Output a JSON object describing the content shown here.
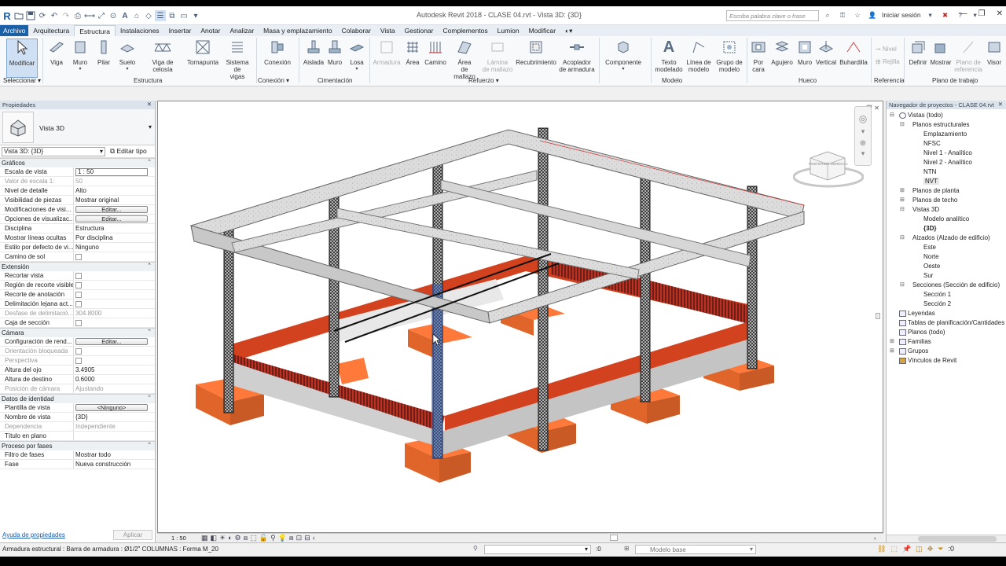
{
  "titlebar": {
    "window_title": "Autodesk Revit 2018 -    CLASE 04.rvt - Vista 3D: {3D}",
    "search_placeholder": "Escriba palabra clave o frase",
    "signin": "Iniciar sesión"
  },
  "tabs": [
    "Archivo",
    "Arquitectura",
    "Estructura",
    "Instalaciones",
    "Insertar",
    "Anotar",
    "Analizar",
    "Masa y emplazamiento",
    "Colaborar",
    "Vista",
    "Gestionar",
    "Complementos",
    "Lumion",
    "Modificar"
  ],
  "active_tab": "Estructura",
  "ribbon": {
    "modify": "Modificar",
    "select": "Seleccionar",
    "panels": [
      "Estructura",
      "Conexión",
      "Cimentación",
      "Refuerzo",
      "Modelo",
      "Hueco",
      "Referencia",
      "Plano de trabajo"
    ],
    "buttons": {
      "viga": "Viga",
      "muro": "Muro",
      "pilar": "Pilar",
      "suelo": "Suelo",
      "celosia": "Viga de celosía",
      "tornapunta": "Tornapunta",
      "sistema1": "Sistema de",
      "sistema2": "vigas",
      "conexion": "Conexión",
      "aislada": "Aislada",
      "muro_c": "Muro",
      "losa": "Losa",
      "armadura": "Armadura",
      "area": "Área",
      "camino": "Camino",
      "area_mallazo1": "Área",
      "area_mallazo2": "de mallazo",
      "lamina1": "Lámina",
      "lamina2": "de mallazo",
      "recubrimiento": "Recubrimiento",
      "acoplador1": "Acoplador",
      "acoplador2": "de armadura",
      "componente": "Componente",
      "texto1": "Texto",
      "texto2": "modelado",
      "linea1": "Línea de",
      "linea2": "modelo",
      "grupo1": "Grupo de",
      "grupo2": "modelo",
      "porcara1": "Por",
      "porcara2": "cara",
      "agujero": "Agujero",
      "muro_h": "Muro",
      "vertical": "Vertical",
      "buhardilla": "Buhardilla",
      "nivel": "Nivel",
      "rejilla": "Rejilla",
      "definir": "Definir",
      "mostrar": "Mostrar",
      "plano_ref1": "Plano de",
      "plano_ref2": "referencia",
      "visor": "Visor"
    }
  },
  "properties": {
    "header": "Propiedades",
    "type_name": "Vista 3D",
    "view_selector": "Vista 3D: {3D}",
    "edit_type": "Editar tipo",
    "sections": {
      "graficos": "Gráficos",
      "extension": "Extensión",
      "camara": "Cámara",
      "identidad": "Datos de identidad",
      "fases": "Proceso por fases"
    },
    "graficos": [
      {
        "k": "Escala de vista",
        "v": "1 : 50"
      },
      {
        "k": "Valor de escala    1:",
        "v": "50"
      },
      {
        "k": "Nivel de detalle",
        "v": "Alto"
      },
      {
        "k": "Visibilidad de piezas",
        "v": "Mostrar original"
      },
      {
        "k": "Modificaciones de visi...",
        "v": "Editar..."
      },
      {
        "k": "Opciones de visualizac...",
        "v": "Editar..."
      },
      {
        "k": "Disciplina",
        "v": "Estructura"
      },
      {
        "k": "Mostrar líneas ocultas",
        "v": "Por disciplina"
      },
      {
        "k": "Estilo por defecto de vi...",
        "v": "Ninguno"
      },
      {
        "k": "Camino de sol",
        "v": ""
      }
    ],
    "extension": [
      {
        "k": "Recortar vista",
        "v": ""
      },
      {
        "k": "Región de recorte visible",
        "v": ""
      },
      {
        "k": "Recorte de anotación",
        "v": ""
      },
      {
        "k": "Delimitación lejana act...",
        "v": ""
      },
      {
        "k": "Desfase de delimitació...",
        "v": "304.8000"
      },
      {
        "k": "Caja de sección",
        "v": ""
      }
    ],
    "camara": [
      {
        "k": "Configuración de rend...",
        "v": "Editar..."
      },
      {
        "k": "Orientación bloqueada",
        "v": ""
      },
      {
        "k": "Perspectiva",
        "v": ""
      },
      {
        "k": "Altura del ojo",
        "v": "3.4905"
      },
      {
        "k": "Altura de destino",
        "v": "0.6000"
      },
      {
        "k": "Posición de cámara",
        "v": "Ajustando"
      }
    ],
    "identidad": [
      {
        "k": "Plantilla de vista",
        "v": "<Ninguno>"
      },
      {
        "k": "Nombre de vista",
        "v": "{3D}"
      },
      {
        "k": "Dependencia",
        "v": "Independiente"
      },
      {
        "k": "Título en plano",
        "v": ""
      }
    ],
    "fases": [
      {
        "k": "Filtro de fases",
        "v": "Mostrar todo"
      },
      {
        "k": "Fase",
        "v": "Nueva construcción"
      }
    ],
    "help": "Ayuda de propiedades",
    "apply": "Aplicar"
  },
  "browser": {
    "header": "Navegador de proyectos - CLASE 04.rvt",
    "items": [
      {
        "label": "Vistas (todo)",
        "indent": 0,
        "tog": "⊟"
      },
      {
        "label": "Planos estructurales",
        "indent": 1,
        "tog": "⊟"
      },
      {
        "label": "Emplazamiento",
        "indent": 2,
        "tog": ""
      },
      {
        "label": "NFSC",
        "indent": 2,
        "tog": ""
      },
      {
        "label": "Nivel 1 - Analítico",
        "indent": 2,
        "tog": ""
      },
      {
        "label": "Nivel 2 - Analítico",
        "indent": 2,
        "tog": ""
      },
      {
        "label": "NTN",
        "indent": 2,
        "tog": ""
      },
      {
        "label": "NVT",
        "indent": 2,
        "tog": ""
      },
      {
        "label": "Planos de planta",
        "indent": 1,
        "tog": "⊞"
      },
      {
        "label": "Planos de techo",
        "indent": 1,
        "tog": "⊞"
      },
      {
        "label": "Vistas 3D",
        "indent": 1,
        "tog": "⊟"
      },
      {
        "label": "Modelo analítico",
        "indent": 2,
        "tog": ""
      },
      {
        "label": "{3D}",
        "indent": 2,
        "tog": ""
      },
      {
        "label": "Alzados (Alzado de edificio)",
        "indent": 1,
        "tog": "⊟"
      },
      {
        "label": "Este",
        "indent": 2,
        "tog": ""
      },
      {
        "label": "Norte",
        "indent": 2,
        "tog": ""
      },
      {
        "label": "Oeste",
        "indent": 2,
        "tog": ""
      },
      {
        "label": "Sur",
        "indent": 2,
        "tog": ""
      },
      {
        "label": "Secciones (Sección de edificio)",
        "indent": 1,
        "tog": "⊟"
      },
      {
        "label": "Sección 1",
        "indent": 2,
        "tog": ""
      },
      {
        "label": "Sección 2",
        "indent": 2,
        "tog": ""
      },
      {
        "label": "Leyendas",
        "indent": 0,
        "tog": ""
      },
      {
        "label": "Tablas de planificación/Cantidades",
        "indent": 0,
        "tog": ""
      },
      {
        "label": "Planos (todo)",
        "indent": 0,
        "tog": ""
      },
      {
        "label": "Familias",
        "indent": 0,
        "tog": "⊞"
      },
      {
        "label": "Grupos",
        "indent": 0,
        "tog": "⊞"
      },
      {
        "label": "Vínculos de Revit",
        "indent": 0,
        "tog": ""
      }
    ]
  },
  "viewport": {
    "scale": "1 : 50",
    "viewcube_label": "POSTERIOR  DERECHA"
  },
  "status": {
    "text": "Armadura estructural : Barra de armadura : Ø1/2\" COLUMNAS : Forma M_20",
    "count": ":0",
    "model": "Modelo base",
    "filter_count": ":0"
  }
}
